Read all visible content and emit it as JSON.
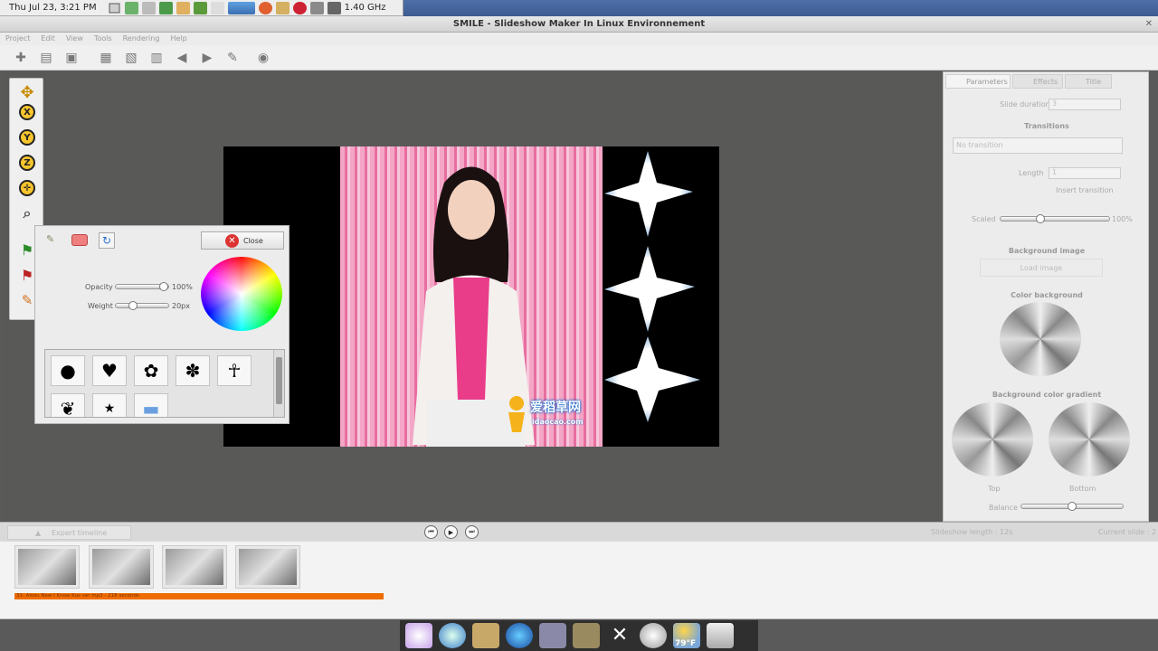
{
  "system_panel": {
    "clock": "Thu Jul 23,  3:21 PM",
    "cpu": "1.40 GHz"
  },
  "window": {
    "title": "SMILE - Slideshow Maker In Linux Environnement",
    "close": "✕"
  },
  "menu": [
    "Project",
    "Edit",
    "View",
    "Tools",
    "Rendering",
    "Help"
  ],
  "draw_panel": {
    "close_label": "Close",
    "opacity_label": "Opacity",
    "opacity_value": "100%",
    "opacity_level": 1.0,
    "weight_label": "Weight",
    "weight_value": "20px",
    "weight_level": 0.3,
    "shapes": [
      "●",
      "♥",
      "✿",
      "✽",
      "☥",
      "❦",
      "★",
      "▬"
    ]
  },
  "photo_watermark": {
    "brand": "爱稻草网",
    "domain": "idaocao.com"
  },
  "right_panel": {
    "tabs": [
      "Parameters",
      "Effects",
      "Title"
    ],
    "slide_duration_label": "Slide duration",
    "slide_duration_value": "3",
    "transitions_heading": "Transitions",
    "transition_value": "No transition",
    "length_label": "Length",
    "length_value": "1",
    "insert_transition": "Insert transition",
    "scaled_label": "Scaled",
    "scaled_value": "100%",
    "scaled_level": 0.35,
    "background_image_heading": "Background image",
    "load_image_label": "Load image",
    "color_background_heading": "Color background",
    "gradient_heading": "Background color gradient",
    "top_label": "Top",
    "bottom_label": "Bottom",
    "balance_label": "Balance",
    "balance_level": 0.5
  },
  "timeline": {
    "expert_label": "Expert timeline",
    "slideshow_length": "Slideshow length : 12s",
    "current_slide": "Current slide : 2",
    "audio_track": "31: Alsou New I Know Kus ver mp3 - 218 seconds"
  },
  "dock": {
    "weather": "79°F"
  }
}
